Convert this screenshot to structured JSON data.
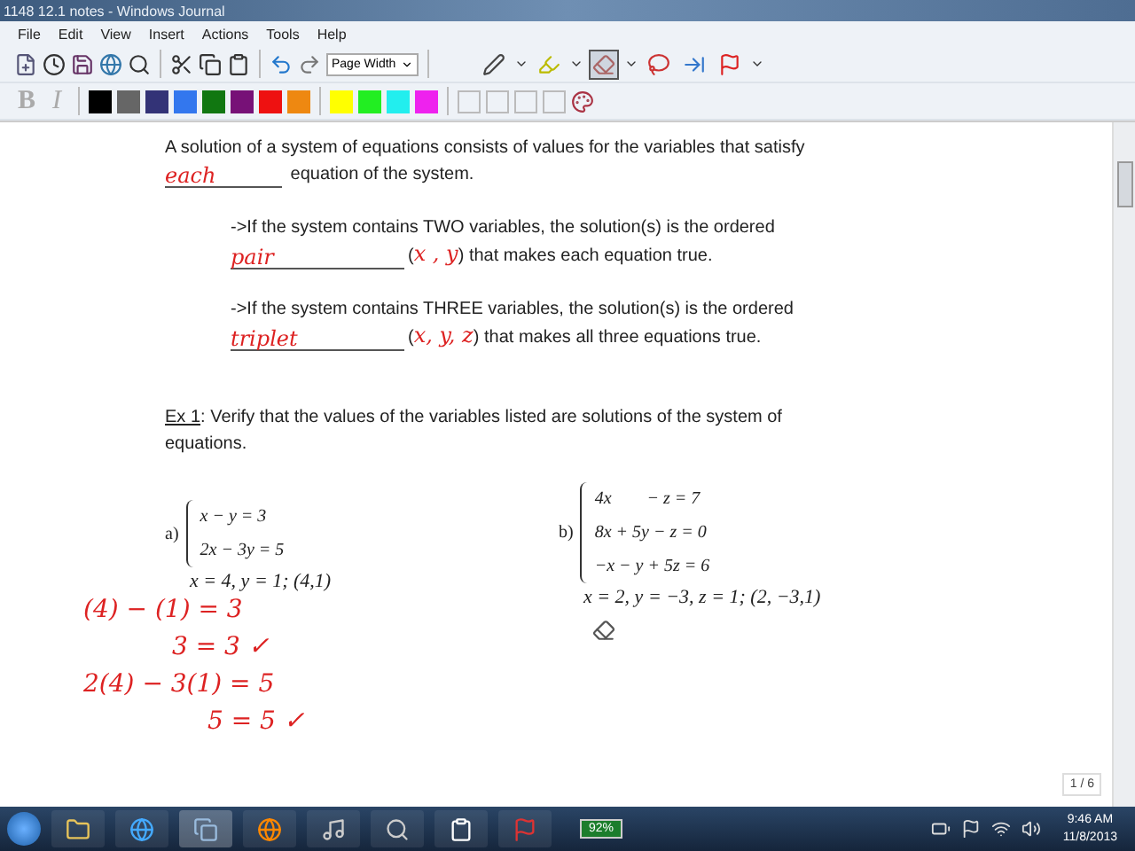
{
  "window": {
    "title": "1148 12.1 notes - Windows Journal"
  },
  "menu": [
    "File",
    "Edit",
    "View",
    "Insert",
    "Actions",
    "Tools",
    "Help"
  ],
  "toolbar": {
    "zoom": "Page Width",
    "tools": [
      {
        "kind": "pen",
        "selected": false
      },
      {
        "kind": "highlighter",
        "selected": false
      },
      {
        "kind": "eraser",
        "selected": true
      },
      {
        "kind": "lasso",
        "selected": false
      },
      {
        "kind": "insert",
        "selected": false
      },
      {
        "kind": "flag",
        "selected": false
      }
    ]
  },
  "format_buttons": [
    {
      "kind": "bold",
      "label": "B"
    },
    {
      "kind": "italic",
      "label": "I"
    }
  ],
  "pen_colors": [
    {
      "color": "#000000"
    },
    {
      "color": "#666666"
    },
    {
      "color": "#333377"
    },
    {
      "color": "#3377ee"
    },
    {
      "color": "#117711"
    },
    {
      "color": "#771177"
    },
    {
      "color": "#ee1111"
    },
    {
      "color": "#ee8811"
    },
    {
      "color": "#ffff00"
    },
    {
      "color": "#22ee22"
    },
    {
      "color": "#22eeee"
    },
    {
      "color": "#ee22ee"
    }
  ],
  "note": {
    "intro": {
      "text": "A solution of a system of equations consists of values for the variables that satisfy",
      "ink": "each",
      "rest": "equation of the system."
    },
    "cases": [
      {
        "text": "->If the system contains TWO variables, the solution(s) is the ordered",
        "ink": "pair",
        "open": "(",
        "ink_vars": "x , y",
        "rest": ") that makes each equation true."
      },
      {
        "text": "->If the system contains THREE variables, the solution(s) is the ordered",
        "ink": "triplet",
        "open": "(",
        "ink_vars": "x, y, z",
        "rest": ") that makes all three equations true."
      }
    ],
    "example": {
      "label": "Ex 1",
      "text": ": Verify that the values of the variables listed are solutions of the system of equations."
    },
    "parts": [
      {
        "label": "a)",
        "equations": [
          "x − y = 3",
          "2x − 3y = 5"
        ],
        "values": "x = 4, y = 1; (4,1)"
      },
      {
        "label": "b)",
        "equations": [
          "4x        − z = 7",
          "8x + 5y − z = 0",
          "−x − y + 5z = 6"
        ],
        "values": "x = 2, y = −3, z = 1; (2, −3,1)"
      }
    ],
    "work": [
      {
        "kind": "step",
        "text": "(4) − (1) = 3"
      },
      {
        "kind": "check",
        "text": "3  = 3 ✓"
      },
      {
        "kind": "step",
        "text": "2(4) − 3(1) = 5"
      },
      {
        "kind": "result",
        "text": "5  = 5 ✓"
      }
    ]
  },
  "page_indicator": "1 / 6",
  "taskbar": {
    "battery": "92%",
    "time": "9:46 AM",
    "date": "11/8/2013"
  }
}
